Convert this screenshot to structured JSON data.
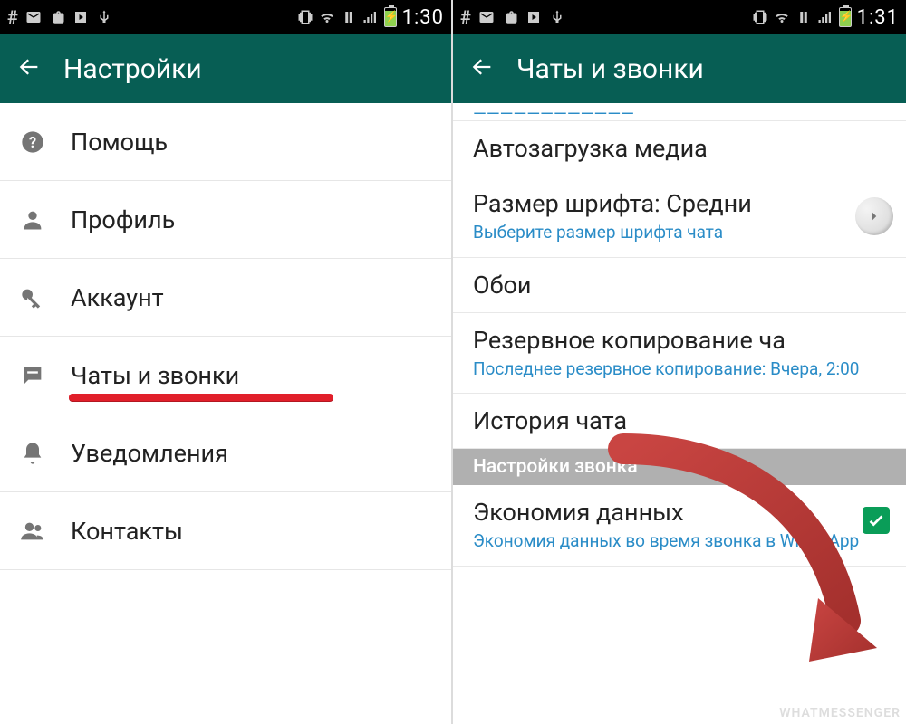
{
  "left": {
    "status": {
      "time": "1:30"
    },
    "appbar": {
      "title": "Настройки"
    },
    "items": [
      {
        "label": "Помощь"
      },
      {
        "label": "Профиль"
      },
      {
        "label": "Аккаунт"
      },
      {
        "label": "Чаты и звонки"
      },
      {
        "label": "Уведомления"
      },
      {
        "label": "Контакты"
      }
    ]
  },
  "right": {
    "status": {
      "time": "1:31"
    },
    "appbar": {
      "title": "Чаты и звонки"
    },
    "items": {
      "auto_media": "Автозагрузка медиа",
      "font_title": "Размер шрифта: Средни",
      "font_sub": "Выберите размер шрифта чата",
      "wallpaper": "Обои",
      "backup_title": "Резервное копирование ча",
      "backup_sub": "Последнее резервное копирование: Вчера, 2:00",
      "history": "История чата",
      "section": "Настройки звонка",
      "data_title": "Экономия данных",
      "data_sub": "Экономия данных во время звонка в WhatsApp"
    }
  },
  "watermark": "WHATMESSENGER"
}
